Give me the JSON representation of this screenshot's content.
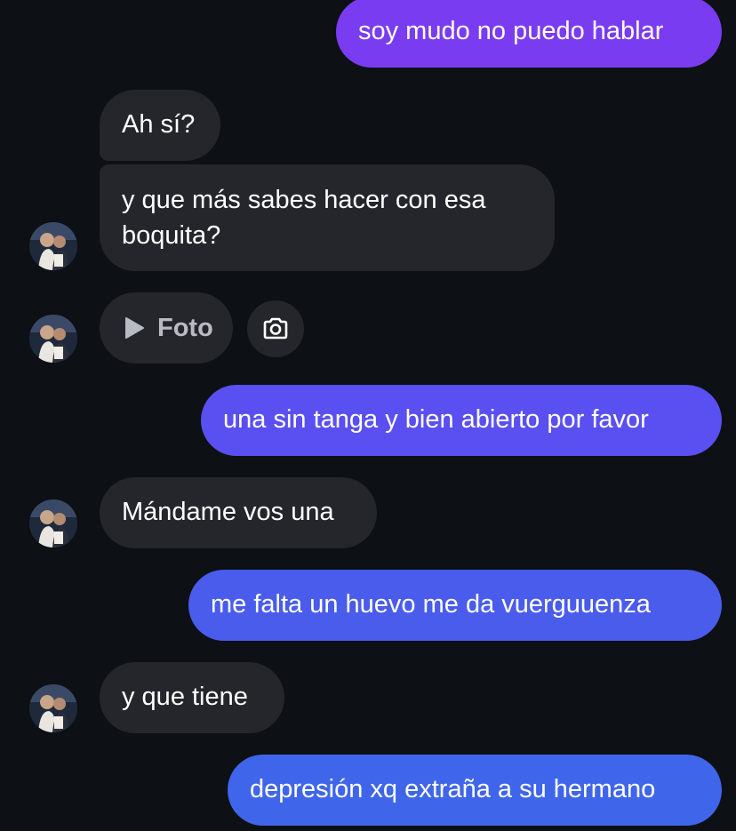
{
  "messages": {
    "m1": {
      "text": "soy mudo no puedo hablar",
      "color": "#7a3cf0"
    },
    "m2": {
      "text": "Ah sí?"
    },
    "m3": {
      "text": "y que más sabes hacer con esa boquita?"
    },
    "m4": {
      "label": "Foto",
      "icon": "play-icon",
      "action_icon": "camera-icon"
    },
    "m5": {
      "text": "una sin tanga y bien abierto por favor",
      "color": "#5a4ff0"
    },
    "m6": {
      "text": "Mándame vos una"
    },
    "m7": {
      "text": "me falta un huevo me da vuerguuenza",
      "color": "#4a5cec"
    },
    "m8": {
      "text": "y que tiene"
    },
    "m9": {
      "text": "depresión xq extraña a su hermano",
      "color": "#3f66ea"
    }
  },
  "colors": {
    "background": "#0d1014",
    "received_bubble": "#24262b",
    "text": "#ffffff",
    "muted_text": "#b8bbc2"
  },
  "avatar": {
    "icon": "contact-avatar"
  }
}
